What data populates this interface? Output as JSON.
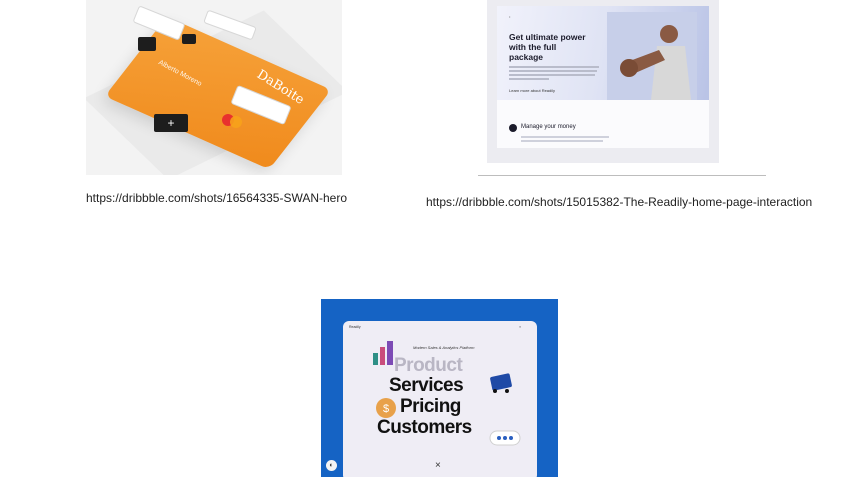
{
  "items": [
    {
      "url": "https://dribbble.com/shots/16564335-SWAN-hero",
      "card": {
        "brand": "DaBoite",
        "holder": "Alberto Moreno"
      }
    },
    {
      "url": "https://dribbble.com/shots/15015382-The-Readily-home-page-interaction",
      "card": {
        "headline": "Get ultimate power with the full package",
        "section": "Manage your money",
        "link": "Learn more about Readily"
      }
    },
    {
      "card": {
        "nav_logo": "Readily",
        "subtitle": "Modern Sales & Analytics Platform",
        "words": [
          "Product",
          "Services",
          "Pricing",
          "Customers"
        ],
        "close_glyph": "×"
      }
    }
  ],
  "colors": {
    "swan_orange": "#f08a1c",
    "readily_bg": "#dfe3f4",
    "saas_blue": "#1563c4"
  }
}
